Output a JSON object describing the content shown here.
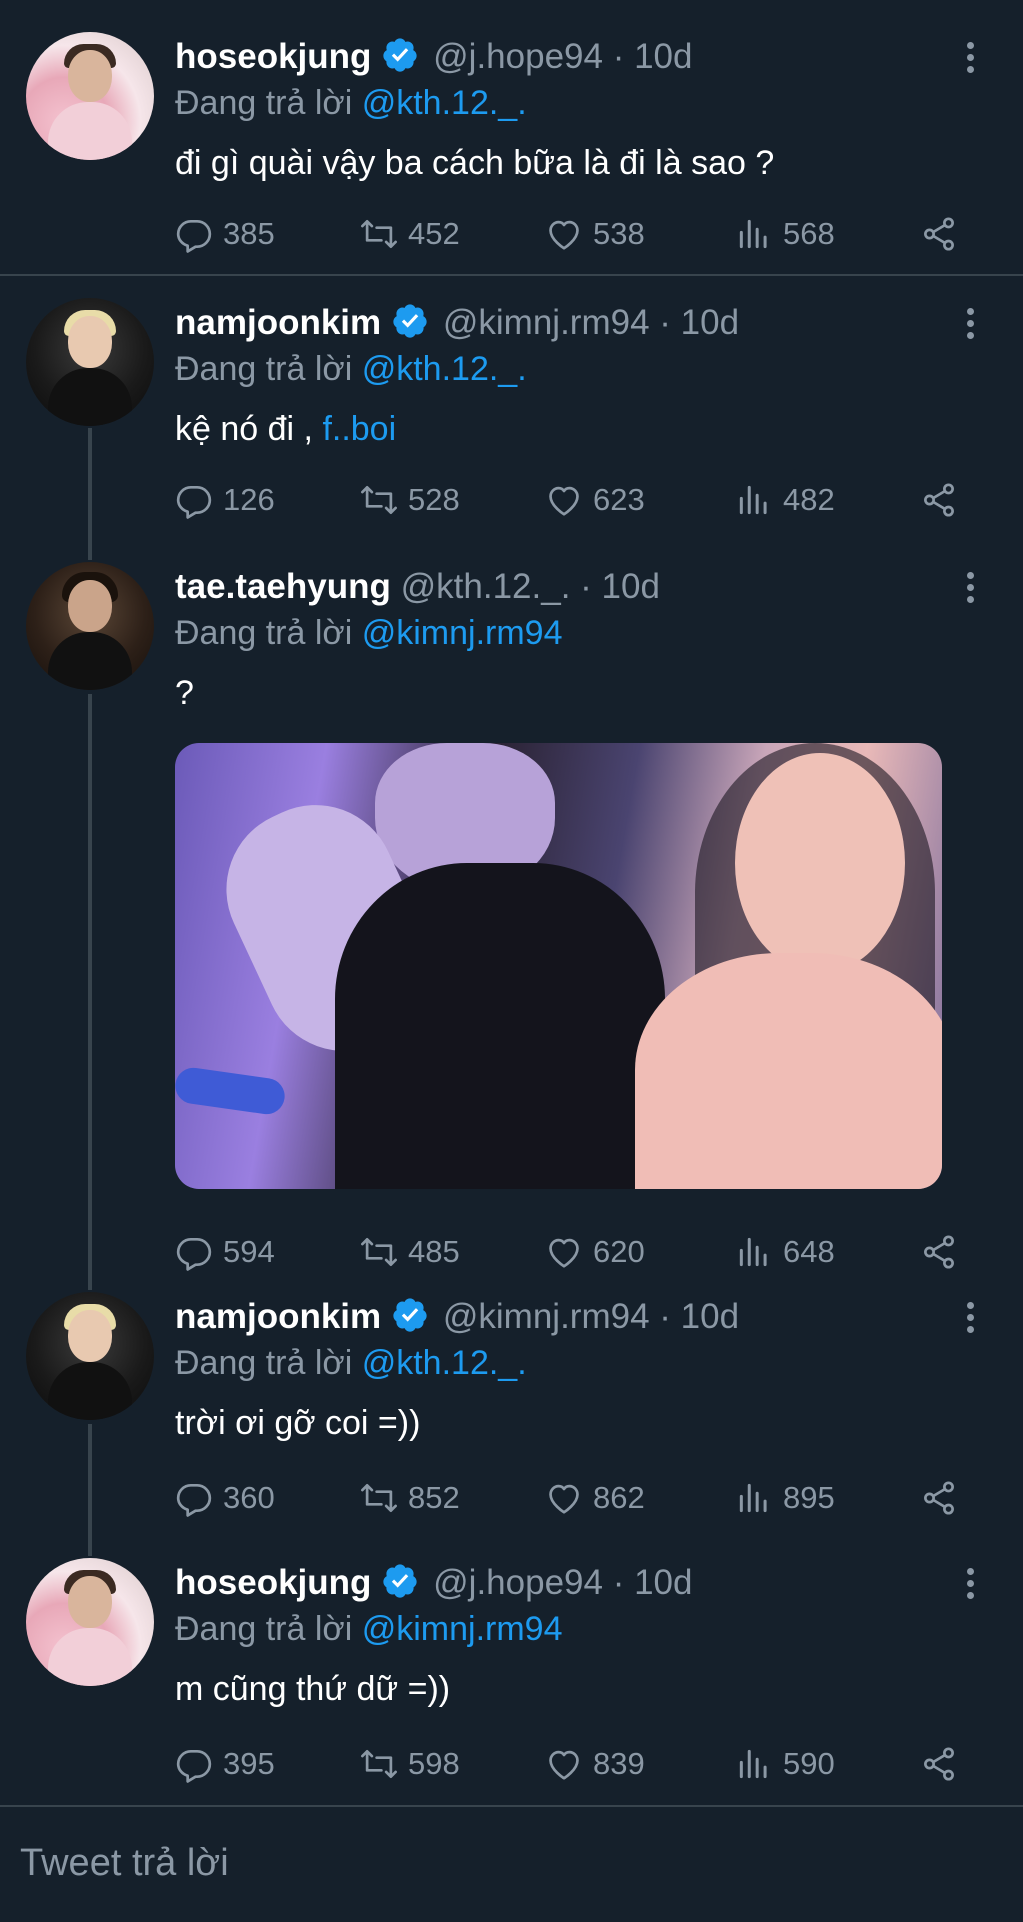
{
  "tweets": [
    {
      "name": "hoseokjung",
      "verified": true,
      "handle": "@j.hope94",
      "time": "· 10d",
      "replying_prefix": "Đang trả lời",
      "replying_to": "@kth.12._.",
      "text": "đi gì quài vậy ba cách bữa là đi là sao ?",
      "link": "",
      "replies": "385",
      "retweets": "452",
      "likes": "538",
      "views": "568"
    },
    {
      "name": "namjoonkim",
      "verified": true,
      "handle": "@kimnj.rm94",
      "time": "· 10d",
      "replying_prefix": "Đang trả lời",
      "replying_to": "@kth.12._.",
      "text": "kệ nó đi ,",
      "link": "f..boi",
      "replies": "126",
      "retweets": "528",
      "likes": "623",
      "views": "482"
    },
    {
      "name": "tae.taehyung",
      "verified": false,
      "handle": "@kth.12._.",
      "time": "· 10d",
      "replying_prefix": "Đang trả lời",
      "replying_to": "@kimnj.rm94",
      "text": "?",
      "link": "",
      "replies": "594",
      "retweets": "485",
      "likes": "620",
      "views": "648"
    },
    {
      "name": "namjoonkim",
      "verified": true,
      "handle": "@kimnj.rm94",
      "time": "· 10d",
      "replying_prefix": "Đang trả lời",
      "replying_to": "@kth.12._.",
      "text": "trời ơi gỡ coi =))",
      "link": "",
      "replies": "360",
      "retweets": "852",
      "likes": "862",
      "views": "895"
    },
    {
      "name": "hoseokjung",
      "verified": true,
      "handle": "@j.hope94",
      "time": "· 10d",
      "replying_prefix": "Đang trả lời",
      "replying_to": "@kimnj.rm94",
      "text": "m cũng thứ dữ =))",
      "link": "",
      "replies": "395",
      "retweets": "598",
      "likes": "839",
      "views": "590"
    }
  ],
  "composer": {
    "placeholder": "Tweet trả lời"
  },
  "colors": {
    "background": "#15202b",
    "accent": "#1d9bf0",
    "muted": "#8b98a5",
    "divider": "#38444d"
  },
  "icons": [
    "verified-badge-icon",
    "more-vertical-icon",
    "reply-icon",
    "retweet-icon",
    "like-icon",
    "views-icon",
    "share-icon"
  ]
}
